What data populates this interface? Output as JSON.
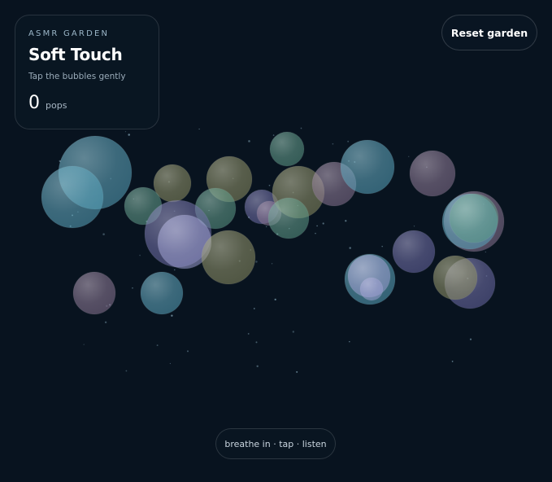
{
  "app": {
    "eyebrow": "ASMR GARDEN",
    "title": "Soft Touch",
    "subtitle": "Tap the bubbles gently",
    "score": "0",
    "score_unit": "pops",
    "reset_label": "Reset garden",
    "hint": "breathe in · tap · listen"
  },
  "colors": {
    "background": "#08131f",
    "teal": "#5aa6bd",
    "green": "#5c9a86",
    "olive": "#8e8f62",
    "purple": "#6b6aa6",
    "mauve": "#8b7591",
    "lavender": "#9a9dcf"
  },
  "bubbles": [
    {
      "color": "teal"
    },
    {
      "color": "teal"
    },
    {
      "color": "olive"
    },
    {
      "color": "green"
    },
    {
      "color": "olive"
    },
    {
      "color": "green"
    },
    {
      "color": "purple"
    },
    {
      "color": "lavender"
    },
    {
      "color": "olive"
    },
    {
      "color": "green"
    },
    {
      "color": "purple"
    },
    {
      "color": "mauve"
    },
    {
      "color": "olive"
    },
    {
      "color": "green"
    },
    {
      "color": "mauve"
    },
    {
      "color": "mauve"
    },
    {
      "color": "teal"
    },
    {
      "color": "mauve"
    },
    {
      "color": "teal"
    },
    {
      "color": "purple"
    },
    {
      "color": "teal"
    },
    {
      "color": "lavender"
    },
    {
      "color": "lavender"
    },
    {
      "color": "purple"
    },
    {
      "color": "olive"
    },
    {
      "color": "mauve"
    },
    {
      "color": "teal"
    },
    {
      "color": "green"
    }
  ]
}
